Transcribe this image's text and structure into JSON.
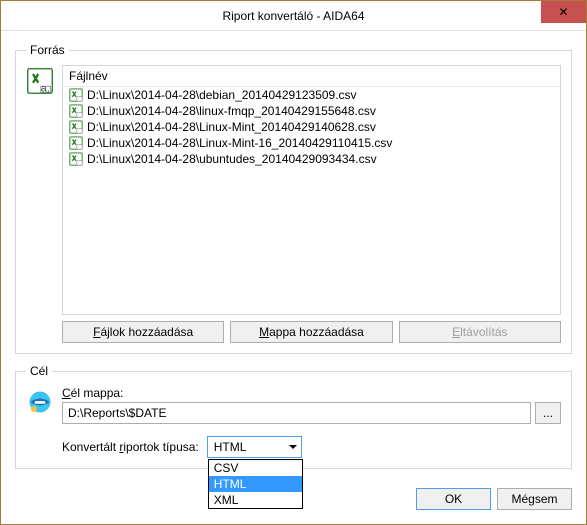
{
  "title": "Riport konvertáló - AIDA64",
  "source": {
    "legend": "Forrás",
    "file_header": "Fájlnév",
    "files": [
      "D:\\Linux\\2014-04-28\\debian_20140429123509.csv",
      "D:\\Linux\\2014-04-28\\linux-fmqp_20140429155648.csv",
      "D:\\Linux\\2014-04-28\\Linux-Mint_20140429140628.csv",
      "D:\\Linux\\2014-04-28\\Linux-Mint-16_20140429110415.csv",
      "D:\\Linux\\2014-04-28\\ubuntudes_20140429093434.csv"
    ],
    "add_files": "Fájlok hozzáadása",
    "add_folder": "Mappa hozzáadása",
    "remove": "Eltávolítás"
  },
  "target": {
    "legend": "Cél",
    "folder_label": "Cél mappa:",
    "folder_path": "D:\\Reports\\$DATE",
    "browse": "...",
    "type_label": "Konvertált riportok típusa:",
    "combo_value": "HTML",
    "options": [
      "CSV",
      "HTML",
      "XML"
    ],
    "selected_index": 1
  },
  "footer": {
    "ok": "OK",
    "cancel": "Mégsem"
  }
}
